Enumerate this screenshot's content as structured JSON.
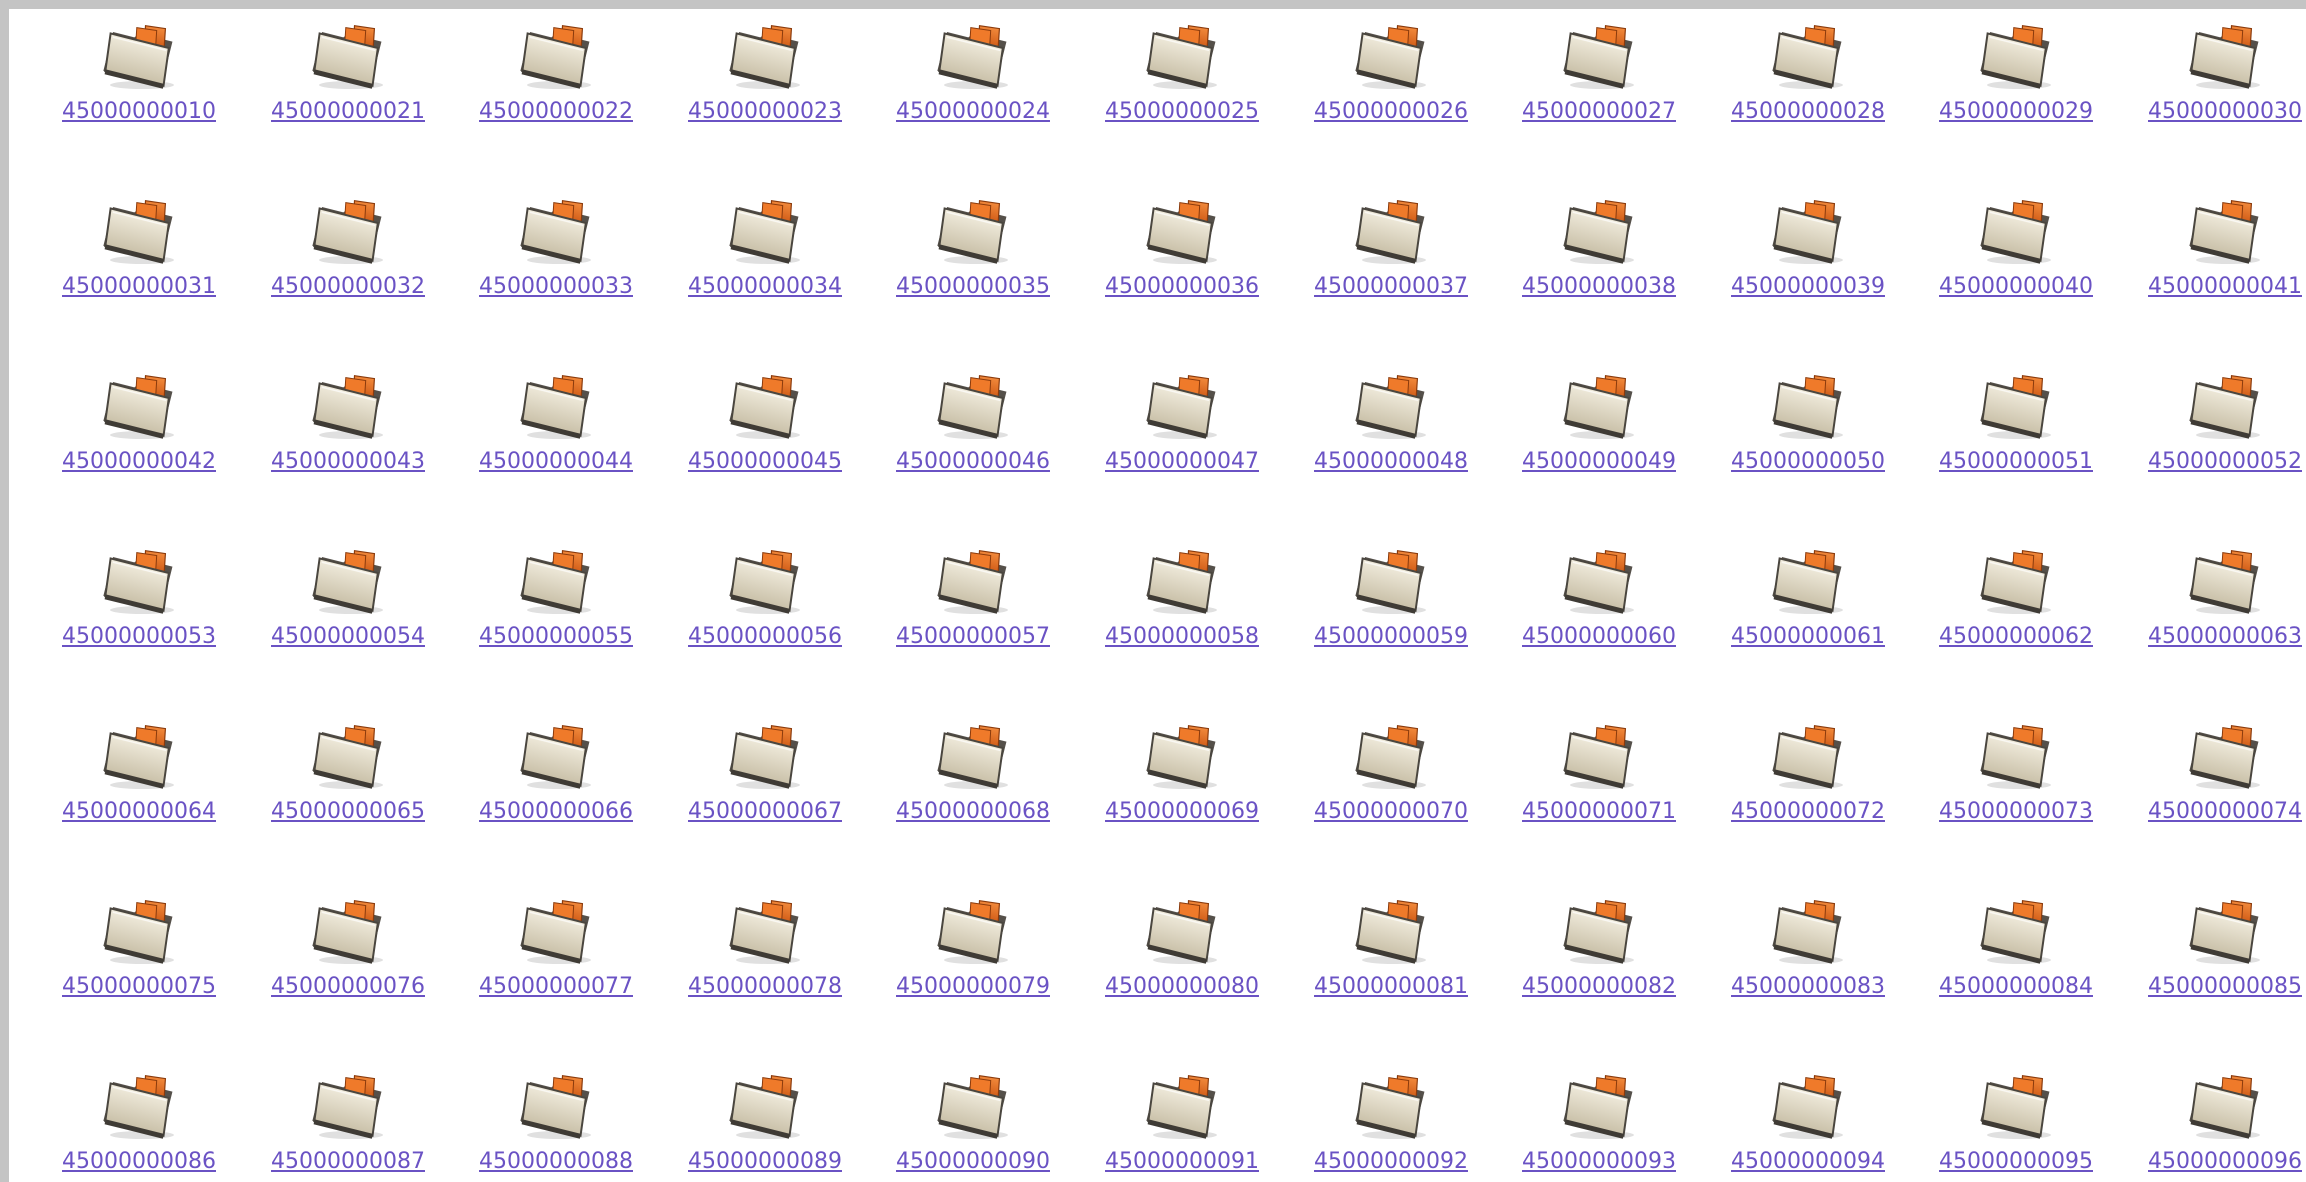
{
  "icons": {
    "folder": "folder-icon"
  },
  "colors": {
    "link": "#6a52c4",
    "folder_body": "#ddd4bd",
    "folder_edge": "#4a463f",
    "folder_tab": "#e06414",
    "frame": "#c4c4c4"
  },
  "folders": [
    {
      "label": "45000000010"
    },
    {
      "label": "45000000021"
    },
    {
      "label": "45000000022"
    },
    {
      "label": "45000000023"
    },
    {
      "label": "45000000024"
    },
    {
      "label": "45000000025"
    },
    {
      "label": "45000000026"
    },
    {
      "label": "45000000027"
    },
    {
      "label": "45000000028"
    },
    {
      "label": "45000000029"
    },
    {
      "label": "45000000030"
    },
    {
      "label": "45000000031"
    },
    {
      "label": "45000000032"
    },
    {
      "label": "45000000033"
    },
    {
      "label": "45000000034"
    },
    {
      "label": "45000000035"
    },
    {
      "label": "45000000036"
    },
    {
      "label": "45000000037"
    },
    {
      "label": "45000000038"
    },
    {
      "label": "45000000039"
    },
    {
      "label": "45000000040"
    },
    {
      "label": "45000000041"
    },
    {
      "label": "45000000042"
    },
    {
      "label": "45000000043"
    },
    {
      "label": "45000000044"
    },
    {
      "label": "45000000045"
    },
    {
      "label": "45000000046"
    },
    {
      "label": "45000000047"
    },
    {
      "label": "45000000048"
    },
    {
      "label": "45000000049"
    },
    {
      "label": "45000000050"
    },
    {
      "label": "45000000051"
    },
    {
      "label": "45000000052"
    },
    {
      "label": "45000000053"
    },
    {
      "label": "45000000054"
    },
    {
      "label": "45000000055"
    },
    {
      "label": "45000000056"
    },
    {
      "label": "45000000057"
    },
    {
      "label": "45000000058"
    },
    {
      "label": "45000000059"
    },
    {
      "label": "45000000060"
    },
    {
      "label": "45000000061"
    },
    {
      "label": "45000000062"
    },
    {
      "label": "45000000063"
    },
    {
      "label": "45000000064"
    },
    {
      "label": "45000000065"
    },
    {
      "label": "45000000066"
    },
    {
      "label": "45000000067"
    },
    {
      "label": "45000000068"
    },
    {
      "label": "45000000069"
    },
    {
      "label": "45000000070"
    },
    {
      "label": "45000000071"
    },
    {
      "label": "45000000072"
    },
    {
      "label": "45000000073"
    },
    {
      "label": "45000000074"
    },
    {
      "label": "45000000075"
    },
    {
      "label": "45000000076"
    },
    {
      "label": "45000000077"
    },
    {
      "label": "45000000078"
    },
    {
      "label": "45000000079"
    },
    {
      "label": "45000000080"
    },
    {
      "label": "45000000081"
    },
    {
      "label": "45000000082"
    },
    {
      "label": "45000000083"
    },
    {
      "label": "45000000084"
    },
    {
      "label": "45000000085"
    },
    {
      "label": "45000000086"
    },
    {
      "label": "45000000087"
    },
    {
      "label": "45000000088"
    },
    {
      "label": "45000000089"
    },
    {
      "label": "45000000090"
    },
    {
      "label": "45000000091"
    },
    {
      "label": "45000000092"
    },
    {
      "label": "45000000093"
    },
    {
      "label": "45000000094"
    },
    {
      "label": "45000000095"
    },
    {
      "label": "45000000096"
    }
  ]
}
